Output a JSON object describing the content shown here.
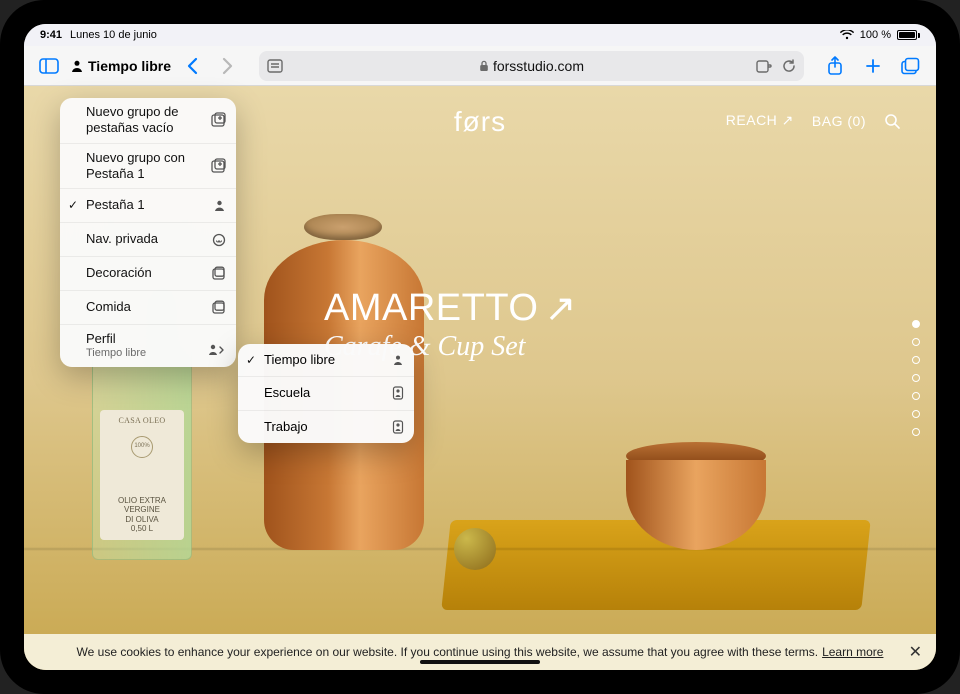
{
  "status": {
    "time": "9:41",
    "date": "Lunes 10 de junio",
    "battery_pct": "100 %"
  },
  "toolbar": {
    "profile_name": "Tiempo libre",
    "url": "forsstudio.com"
  },
  "tab_menu": {
    "new_empty_group": "Nuevo grupo de pestañas vacío",
    "new_group_with_tab": "Nuevo grupo con Pestaña 1",
    "tab1": "Pestaña 1",
    "private": "Nav. privada",
    "group_deco": "Decoración",
    "group_food": "Comida",
    "profile_label": "Perfil",
    "profile_current": "Tiempo libre"
  },
  "profiles": {
    "p1": "Tiempo libre",
    "p2": "Escuela",
    "p3": "Trabajo"
  },
  "site": {
    "logo": "førs",
    "reach": "REACH ↗",
    "bag": "BAG (0)",
    "hero_title": "AMARETTO",
    "hero_sub": "Carafe & Cup Set",
    "bottle_l1": "OLIO EXTRA",
    "bottle_l2": "VERGINE",
    "bottle_l3": "DI OLIVA",
    "bottle_l4": "0,50 L"
  },
  "cookies": {
    "text": "We use cookies to enhance your experience on our website. If you continue using this website, we assume that you agree with these terms.",
    "learn": "Learn more"
  }
}
